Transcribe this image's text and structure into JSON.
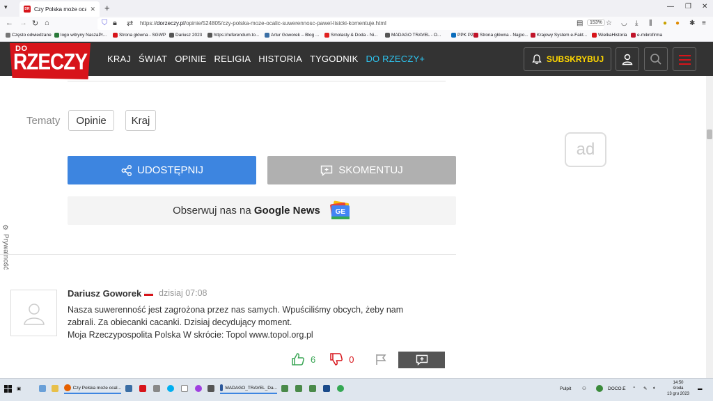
{
  "browser": {
    "tab_title": "Czy Polska może ocalić suwere...",
    "tab_close": "✕",
    "new_tab": "+",
    "url_prefix": "https://",
    "url_domain": "dorzeczy.pl",
    "url_path": "/opinie/524805/czy-polska-moze-ocalic-suwerennosc-pawel-lisicki-komentuje.html",
    "zoom": "153%",
    "bookmarks": [
      "Często odwiedzane",
      "logo witryny NaszaPr...",
      "Strona główna - SGWP",
      "Dariusz 2023",
      "https://referendum.to...",
      "Artur Goworek – Blog ...",
      "Smolasty & Doda - Ni...",
      "MADAGO TRAVEL - O...",
      "PPK PZU",
      "Strona główna - Najpo...",
      "Krajowy System e-Fakt...",
      "WielkaHistoria",
      "e-mikrofirma"
    ],
    "bookmark_colors": [
      "#777777",
      "#2a7a3a",
      "#d7141a",
      "#555555",
      "#555555",
      "#3a6ea5",
      "#e02020",
      "#555555",
      "#0a6cbc",
      "#c0142a",
      "#c0142a",
      "#d7141a",
      "#c0142a"
    ]
  },
  "site": {
    "logo_top": "DO",
    "logo_main": "RZECZY",
    "nav": [
      "KRAJ",
      "ŚWIAT",
      "OPINIE",
      "RELIGIA",
      "HISTORIA",
      "TYGODNIK"
    ],
    "nav_plus": "DO RZECZY+",
    "subscribe": "SUBSKRYBUJ"
  },
  "article": {
    "topics_label": "Tematy",
    "topics": [
      "Opinie",
      "Kraj"
    ],
    "share_label": "UDOSTĘPNIJ",
    "comment_label": "SKOMENTUJ",
    "gnews_prefix": "Obserwuj nas na",
    "gnews_bold": "Google News",
    "gnews_icon": "GE",
    "privacy": "Prywatność",
    "ad": "ad"
  },
  "comment": {
    "author": "Dariusz Goworek",
    "time": "dzisiaj 07:08",
    "lines": [
      "Nasza suwerenność jest zagrożona przez nas samych. Wpuściliśmy obcych, żeby nam",
      "zabrali. Za obiecanki cacanki. Dzisiaj decydujący moment.",
      "Moja Rzeczypospolita Polska W skrócie: Topol www.topol.org.pl"
    ],
    "likes": "6",
    "dislikes": "0"
  },
  "taskbar": {
    "items": [
      "Czy Polska może ocal...",
      "MADAGO_TRAVEL_Da..."
    ],
    "pulpit": "Pulpit",
    "doco": "DOCO.E",
    "time": "14:50",
    "day": "środa",
    "date": "13 gru 2023"
  },
  "colors": {
    "brand_red": "#d7141a",
    "share_blue": "#3d85e0",
    "plus_cyan": "#2ec5f0",
    "subscribe_yellow": "#ffd700"
  }
}
